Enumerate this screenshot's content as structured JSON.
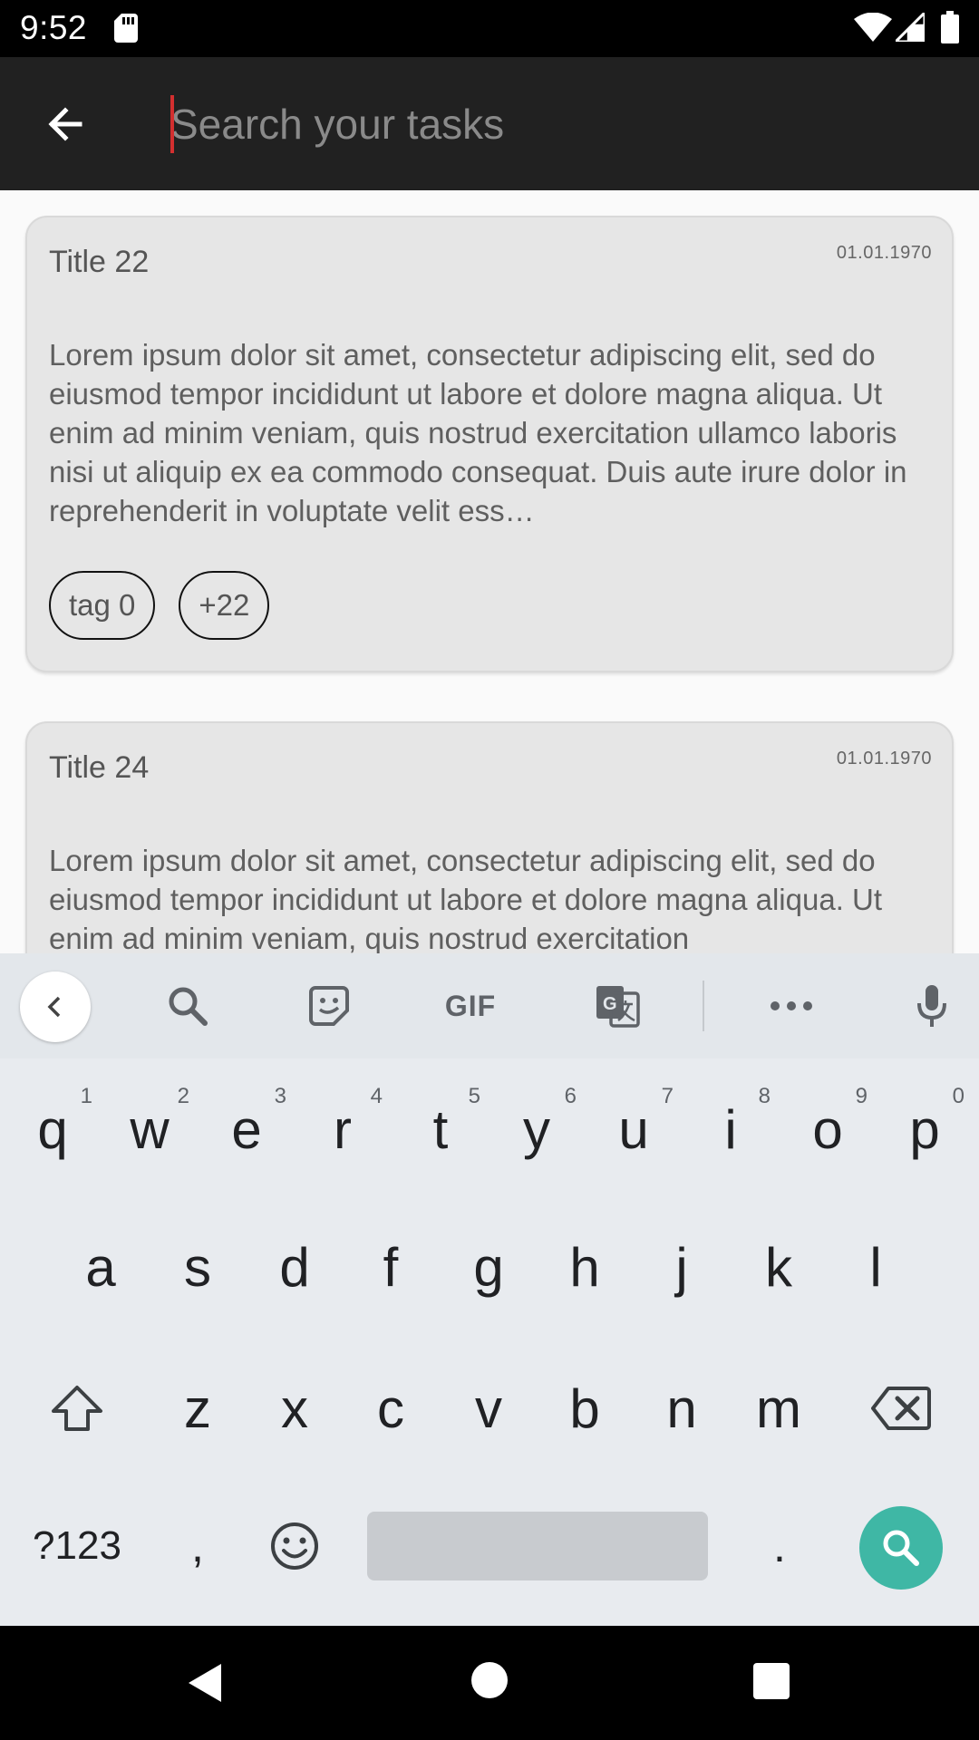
{
  "status_bar": {
    "time": "9:52",
    "icons": [
      "sd-card-icon",
      "wifi-icon",
      "signal-icon",
      "battery-icon"
    ]
  },
  "toolbar": {
    "back_icon": "arrow-left-icon",
    "search_placeholder": "Search your tasks",
    "search_value": ""
  },
  "tasks": [
    {
      "title": "Title 22",
      "date": "01.01.1970",
      "body": "Lorem ipsum dolor sit amet, consectetur adipiscing elit, sed do eiusmod tempor incididunt ut labore et dolore magna aliqua. Ut enim ad minim veniam, quis nostrud exercitation ullamco laboris nisi ut aliquip ex ea commodo consequat. Duis aute irure dolor in reprehenderit in voluptate velit ess…",
      "tags": [
        "tag 0",
        "+22"
      ]
    },
    {
      "title": "Title 24",
      "date": "01.01.1970",
      "body": "Lorem ipsum dolor sit amet, consectetur adipiscing elit, sed do eiusmod tempor incididunt ut labore et dolore magna aliqua. Ut enim ad minim veniam, quis nostrud exercitation"
    }
  ],
  "keyboard": {
    "toolbar_icons": [
      "chevron-left-icon",
      "search-icon",
      "sticker-icon",
      "gif-icon",
      "translate-icon",
      "more-icon",
      "microphone-icon"
    ],
    "gif_label": "GIF",
    "row1": [
      "q",
      "w",
      "e",
      "r",
      "t",
      "y",
      "u",
      "i",
      "o",
      "p"
    ],
    "row1_hints": [
      "1",
      "2",
      "3",
      "4",
      "5",
      "6",
      "7",
      "8",
      "9",
      "0"
    ],
    "row2": [
      "a",
      "s",
      "d",
      "f",
      "g",
      "h",
      "j",
      "k",
      "l"
    ],
    "row3": [
      "z",
      "x",
      "c",
      "v",
      "b",
      "n",
      "m"
    ],
    "symbols_label": "?123",
    "comma": ",",
    "period": ".",
    "accent_color": "#3fb7a5"
  },
  "nav_bar": {
    "icons": [
      "nav-back-icon",
      "nav-home-icon",
      "nav-recents-icon"
    ]
  }
}
